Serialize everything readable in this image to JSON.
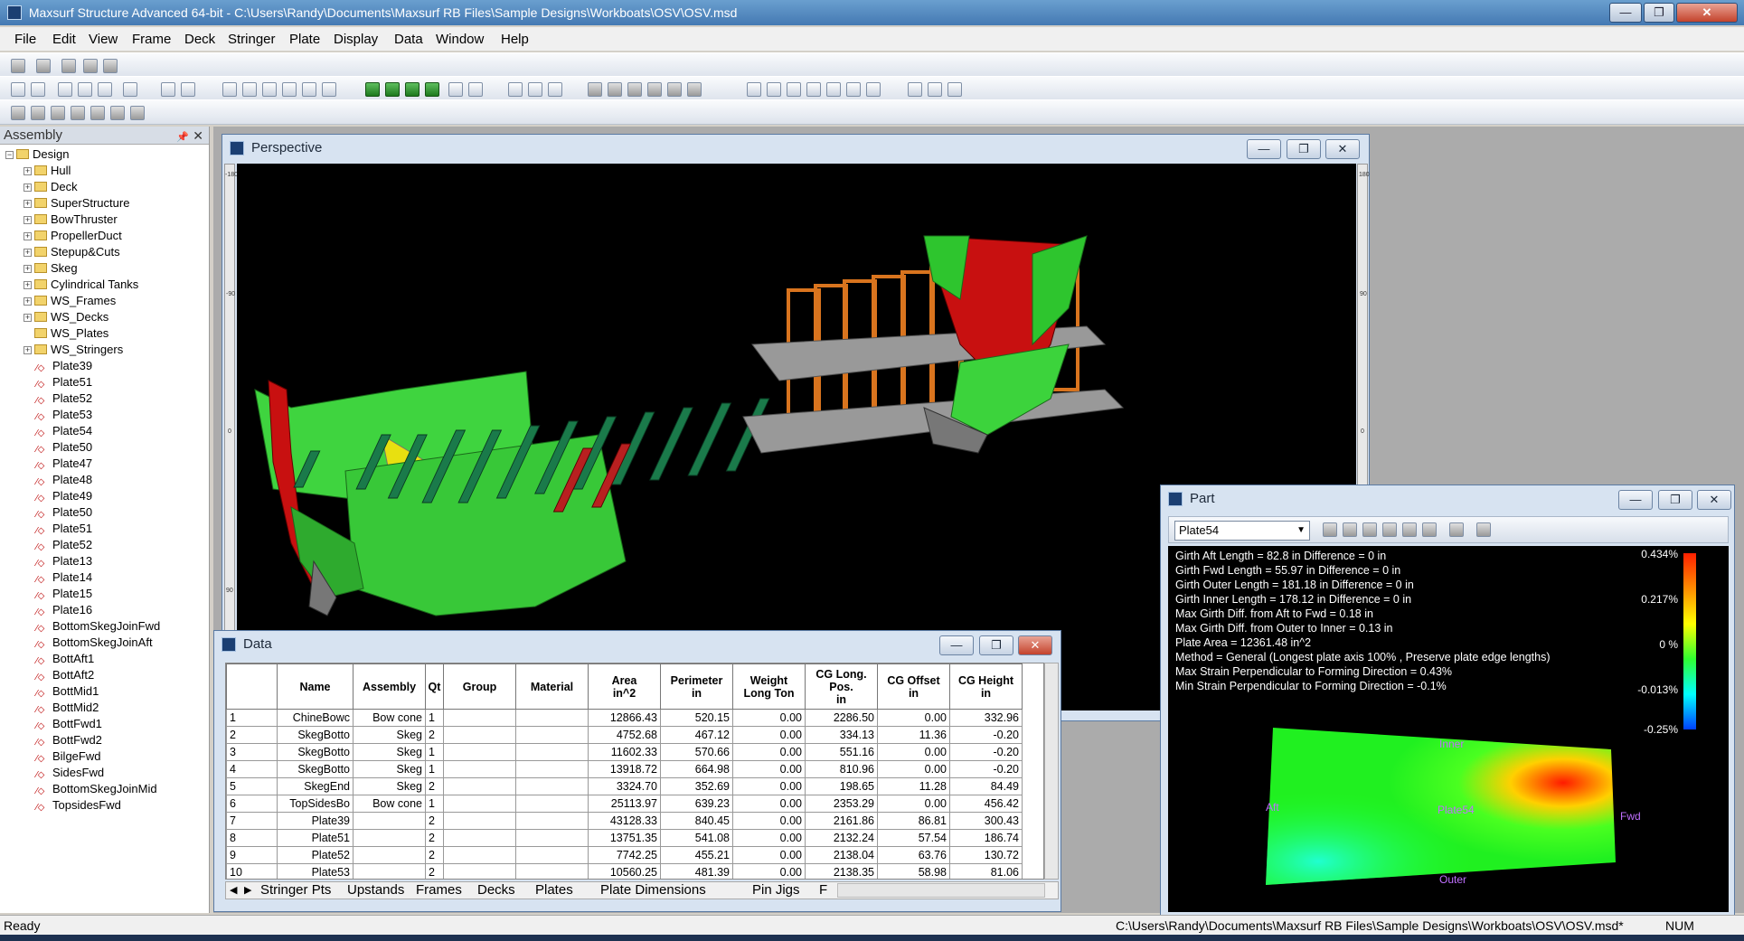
{
  "window": {
    "title": "Maxsurf Structure Advanced 64-bit - C:\\Users\\Randy\\Documents\\Maxsurf RB Files\\Sample Designs\\Workboats\\OSV\\OSV.msd",
    "min": "—",
    "max": "❐",
    "close": "✕"
  },
  "menu": [
    "File",
    "Edit",
    "View",
    "Frame",
    "Deck",
    "Stringer",
    "Plate",
    "Display",
    "Data",
    "Window",
    "Help"
  ],
  "assembly": {
    "title": "Assembly",
    "pin": "📌",
    "close": "✕",
    "root": "Design",
    "folders": [
      "Hull",
      "Deck",
      "SuperStructure",
      "BowThruster",
      "PropellerDuct",
      "Stepup&Cuts",
      "Skeg",
      "Cylindrical Tanks",
      "WS_Frames",
      "WS_Decks",
      "WS_Plates",
      "WS_Stringers"
    ],
    "plates": [
      "Plate39",
      "Plate51",
      "Plate52",
      "Plate53",
      "Plate54",
      "Plate50",
      "Plate47",
      "Plate48",
      "Plate49",
      "Plate50",
      "Plate51",
      "Plate52",
      "Plate13",
      "Plate14",
      "Plate15",
      "Plate16",
      "BottomSkegJoinFwd",
      "BottomSkegJoinAft",
      "BottAft1",
      "BottAft2",
      "BottMid1",
      "BottMid2",
      "BottFwd1",
      "BottFwd2",
      "BilgeFwd",
      "SidesFwd",
      "BottomSkegJoinMid",
      "TopsidesFwd"
    ]
  },
  "perspective": {
    "title": "Perspective",
    "ruler_left": [
      "-180",
      "-90",
      "0",
      "90"
    ],
    "ruler_right": [
      "180",
      "90",
      "0"
    ]
  },
  "part": {
    "title": "Part",
    "selected": "Plate54",
    "info": [
      "Girth Aft Length = 82.8 in Difference = 0 in",
      "Girth Fwd Length = 55.97 in Difference = 0 in",
      "Girth Outer Length = 181.18 in Difference = 0 in",
      "Girth Inner Length = 178.12 in Difference = 0 in",
      "Max Girth Diff. from Aft to Fwd = 0.18 in",
      "Max Girth Diff. from Outer to Inner = 0.13 in",
      "Plate Area = 12361.48 in^2",
      "Method = General (Longest plate axis 100% , Preserve plate edge lengths)",
      "Max Strain Perpendicular to Forming Direction = 0.43%",
      "Min Strain Perpendicular to Forming Direction = -0.1%"
    ],
    "scale": [
      "0.434%",
      "0.217%",
      "0 %",
      "-0.013%",
      "-0.25%"
    ],
    "plate_labels": {
      "inner": "Inner",
      "outer": "Outer",
      "aft": "Aft",
      "fwd": "Fwd",
      "name": "Plate54"
    }
  },
  "data": {
    "title": "Data",
    "columns": [
      "",
      "Name",
      "Assembly",
      "Qt",
      "Group",
      "Material",
      "Area\nin^2",
      "Perimeter\nin",
      "Weight\nLong Ton",
      "CG Long.\nPos.\nin",
      "CG Offset\nin",
      "CG Height\nin"
    ],
    "rows": [
      [
        "1",
        "ChineBowc",
        "Bow cone",
        "1",
        "",
        "",
        "12866.43",
        "520.15",
        "0.00",
        "2286.50",
        "0.00",
        "332.96"
      ],
      [
        "2",
        "SkegBotto",
        "Skeg",
        "2",
        "",
        "",
        "4752.68",
        "467.12",
        "0.00",
        "334.13",
        "11.36",
        "-0.20"
      ],
      [
        "3",
        "SkegBotto",
        "Skeg",
        "1",
        "",
        "",
        "11602.33",
        "570.66",
        "0.00",
        "551.16",
        "0.00",
        "-0.20"
      ],
      [
        "4",
        "SkegBotto",
        "Skeg",
        "1",
        "",
        "",
        "13918.72",
        "664.98",
        "0.00",
        "810.96",
        "0.00",
        "-0.20"
      ],
      [
        "5",
        "SkegEnd",
        "Skeg",
        "2",
        "",
        "",
        "3324.70",
        "352.69",
        "0.00",
        "198.65",
        "11.28",
        "84.49"
      ],
      [
        "6",
        "TopSidesBo",
        "Bow cone",
        "1",
        "",
        "",
        "25113.97",
        "639.23",
        "0.00",
        "2353.29",
        "0.00",
        "456.42"
      ],
      [
        "7",
        "Plate39",
        "",
        "2",
        "",
        "",
        "43128.33",
        "840.45",
        "0.00",
        "2161.86",
        "86.81",
        "300.43"
      ],
      [
        "8",
        "Plate51",
        "",
        "2",
        "",
        "",
        "13751.35",
        "541.08",
        "0.00",
        "2132.24",
        "57.54",
        "186.74"
      ],
      [
        "9",
        "Plate52",
        "",
        "2",
        "",
        "",
        "7742.25",
        "455.21",
        "0.00",
        "2138.04",
        "63.76",
        "130.72"
      ],
      [
        "10",
        "Plate53",
        "",
        "2",
        "",
        "",
        "10560.25",
        "481.39",
        "0.00",
        "2138.35",
        "58.98",
        "81.06"
      ]
    ],
    "tabs": [
      "Stringer Pts",
      "Upstands",
      "Frames",
      "Decks",
      "Plates",
      "Plate Dimensions",
      "Pin Jigs",
      "F"
    ]
  },
  "status": {
    "left": "Ready",
    "path": "C:\\Users\\Randy\\Documents\\Maxsurf RB Files\\Sample Designs\\Workboats\\OSV\\OSV.msd*",
    "num": "NUM"
  }
}
